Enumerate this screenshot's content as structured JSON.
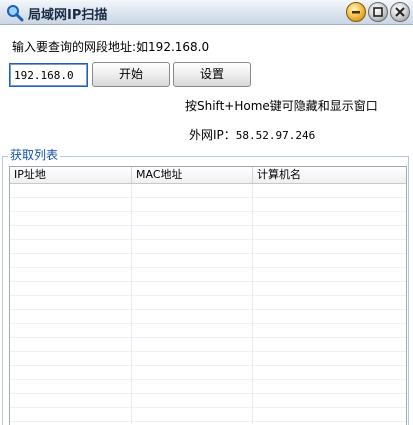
{
  "window": {
    "title": "局域网IP扫描"
  },
  "form": {
    "prompt_label": "输入要查询的网段地址:如192.168.0",
    "ip_value": "192.168.0",
    "start_button": "开始",
    "settings_button": "设置"
  },
  "hint": {
    "shortcut_text": "按Shift+Home键可隐藏和显示窗口"
  },
  "external_ip": {
    "label": "外网IP：",
    "value": "58.52.97.246"
  },
  "results": {
    "group_title": "获取列表",
    "columns": [
      "IP址地",
      "MAC地址",
      "计算机名"
    ],
    "rows": []
  },
  "colors": {
    "group_title": "#1250a5",
    "titlebar_text": "#1b2a44"
  }
}
